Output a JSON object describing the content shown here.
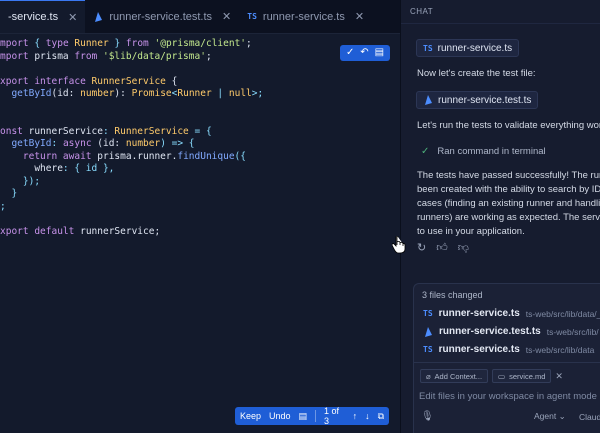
{
  "editor": {
    "tabs": [
      {
        "label": "-service.ts",
        "icon": "close-icon",
        "active": true
      },
      {
        "label": "runner-service.test.ts",
        "icon": "prisma-icon",
        "active": false
      },
      {
        "label": "runner-service.ts",
        "icon": "ts-icon",
        "active": false
      }
    ],
    "ts_badge": "TS",
    "close_glyph": "✕",
    "code_lines": [
      [
        "mport ",
        "{ ",
        "type ",
        "Runner ",
        "} ",
        "from ",
        "'@prisma/client'",
        ";"
      ],
      [
        "mport ",
        "prisma ",
        "from ",
        "'$lib/data/prisma'",
        ";"
      ],
      [
        ""
      ],
      [
        "xport ",
        "interface ",
        "RunnerService ",
        "{"
      ],
      [
        "  getById",
        "(id: ",
        "number",
        "): ",
        "Promise",
        "<",
        "Runner ",
        "| ",
        "null",
        ">;"
      ],
      [
        ""
      ],
      [
        ""
      ],
      [
        "onst ",
        "runnerService",
        ": ",
        "RunnerService ",
        "= {"
      ],
      [
        "  getById",
        ": ",
        "async ",
        "(id: ",
        "number",
        ") => {"
      ],
      [
        "    return ",
        "await ",
        "prisma",
        ".runner.",
        "findUnique",
        "({"
      ],
      [
        "      where",
        ": { id },"
      ],
      [
        "    });"
      ],
      [
        "  }"
      ],
      [
        ";"
      ],
      [
        ""
      ],
      [
        "xport ",
        "default ",
        "runnerService",
        ";"
      ]
    ],
    "review_bar": {
      "keep": "Keep",
      "undo": "Undo",
      "page": "1 of 3"
    }
  },
  "chat": {
    "header": "CHAT",
    "file_pill_1": "runner-service.ts",
    "message_1": "Now let's create the test file:",
    "file_pill_2": "runner-service.test.ts",
    "message_2": "Let's run the tests to validate everything work",
    "ran_command": "Ran command in terminal",
    "message_3_lines": [
      "The tests have passed successfully! The runn",
      "been created with the ability to search by ID, a",
      "cases (finding an existing runner and handlin",
      "runners) are working as expected. The service",
      "to use in your application."
    ]
  },
  "changes": {
    "title": "3 files changed",
    "files": [
      {
        "name": "runner-service.ts",
        "path": "ts-web/src/lib/data/__",
        "icon": "ts-icon"
      },
      {
        "name": "runner-service.test.ts",
        "path": "ts-web/src/lib/",
        "icon": "prisma-icon"
      },
      {
        "name": "runner-service.ts",
        "path": "ts-web/src/lib/data",
        "icon": "ts-icon"
      }
    ]
  },
  "composer": {
    "add_context": "Add Context...",
    "attached_file": "service.md",
    "placeholder": "Edit files in your workspace in agent mode",
    "mode": "Agent",
    "model": "Claude"
  },
  "colors": {
    "accent": "#1f5ed6",
    "ts_blue": "#4c8dff",
    "success": "#4caf7a"
  }
}
